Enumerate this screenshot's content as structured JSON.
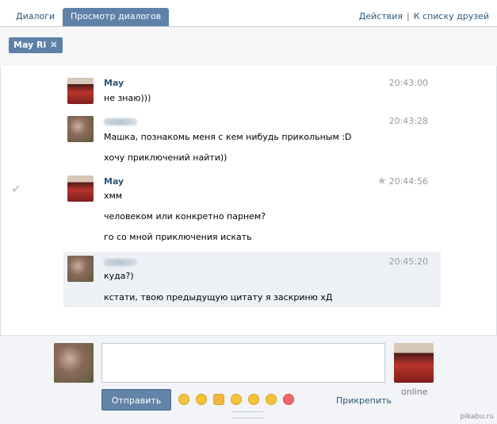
{
  "tabs": [
    {
      "label": "Диалоги"
    },
    {
      "label": "Просмотр диалогов"
    }
  ],
  "actions": {
    "left": "Действия",
    "sep": "|",
    "right": "К списку друзей"
  },
  "chip": {
    "name": "May Ri",
    "close": "✖"
  },
  "messages": [
    {
      "author": "May",
      "time": "20:43:00",
      "lines": [
        "не знаю)))"
      ]
    },
    {
      "author": "",
      "time": "20:43:28",
      "lines": [
        "Машка, познакомь меня с кем нибудь прикольным :D",
        "хочу приключений найти))"
      ]
    },
    {
      "author": "May",
      "time": "20:44:56",
      "lines": [
        "хмм",
        "человеком или конкретно парнем?",
        "го со мной приключения искать"
      ]
    },
    {
      "author": "",
      "time": "20:45:20",
      "lines": [
        "куда?)",
        "кстати, твою предыдущую цитату я заскриню хД"
      ]
    }
  ],
  "composer": {
    "send_label": "Отправить",
    "attach_label": "Прикрепить",
    "status": "online",
    "textarea_value": ""
  },
  "icons": {
    "check": "✔",
    "star": "★",
    "smile": "☺"
  },
  "watermark": "pikabu.ru",
  "colors": {
    "accent": "#5e81a8",
    "link": "#2b587a",
    "highlight": "#edf1f5"
  }
}
